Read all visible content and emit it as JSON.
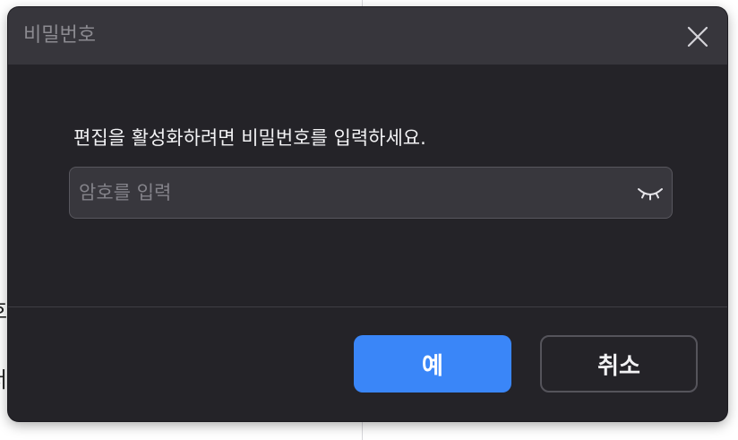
{
  "background": {
    "partial_text_1": "호",
    "partial_text_2": "서"
  },
  "dialog": {
    "title": "비밀번호",
    "close_icon": "close-icon",
    "message": "편집을 활성화하려면 비밀번호를 입력하세요.",
    "password": {
      "value": "",
      "placeholder": "암호를 입력",
      "toggle_icon": "eye-closed-icon"
    },
    "buttons": {
      "ok_label": "예",
      "cancel_label": "취소"
    }
  },
  "colors": {
    "primary_button": "#3a86f8",
    "dialog_background": "#242328",
    "titlebar_background": "#37363c"
  }
}
